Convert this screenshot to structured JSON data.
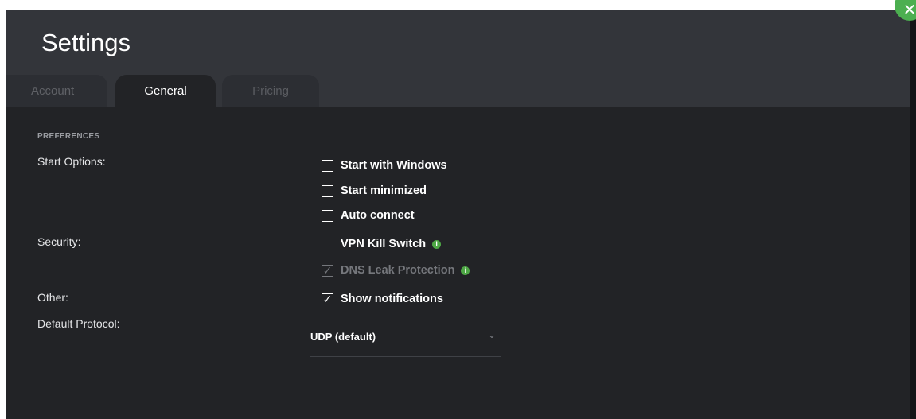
{
  "window": {
    "title": "Settings"
  },
  "tabs": [
    {
      "label": "Account",
      "active": false
    },
    {
      "label": "General",
      "active": true
    },
    {
      "label": "Pricing",
      "active": false
    }
  ],
  "preferences": {
    "section_title": "PREFERENCES",
    "start_options_label": "Start Options:",
    "security_label": "Security:",
    "other_label": "Other:",
    "default_protocol_label": "Default Protocol:"
  },
  "options": {
    "start_with_windows": {
      "label": "Start with Windows",
      "checked": false
    },
    "start_minimized": {
      "label": "Start minimized",
      "checked": false
    },
    "auto_connect": {
      "label": "Auto connect",
      "checked": false
    },
    "vpn_kill_switch": {
      "label": "VPN Kill Switch",
      "checked": false
    },
    "dns_leak_protection": {
      "label": "DNS Leak Protection",
      "checked": true,
      "disabled": true
    },
    "show_notifications": {
      "label": "Show notifications",
      "checked": true
    }
  },
  "protocol": {
    "selected": "UDP (default)"
  },
  "glyphs": {
    "check": "✓",
    "unchecked": "",
    "info": "i",
    "chevron": "⌄",
    "close": "✕"
  },
  "colors": {
    "background": "#222326",
    "header": "#33353a",
    "accent": "#4caf50",
    "info_icon": "#4ea745",
    "disabled_text": "#75777c"
  }
}
